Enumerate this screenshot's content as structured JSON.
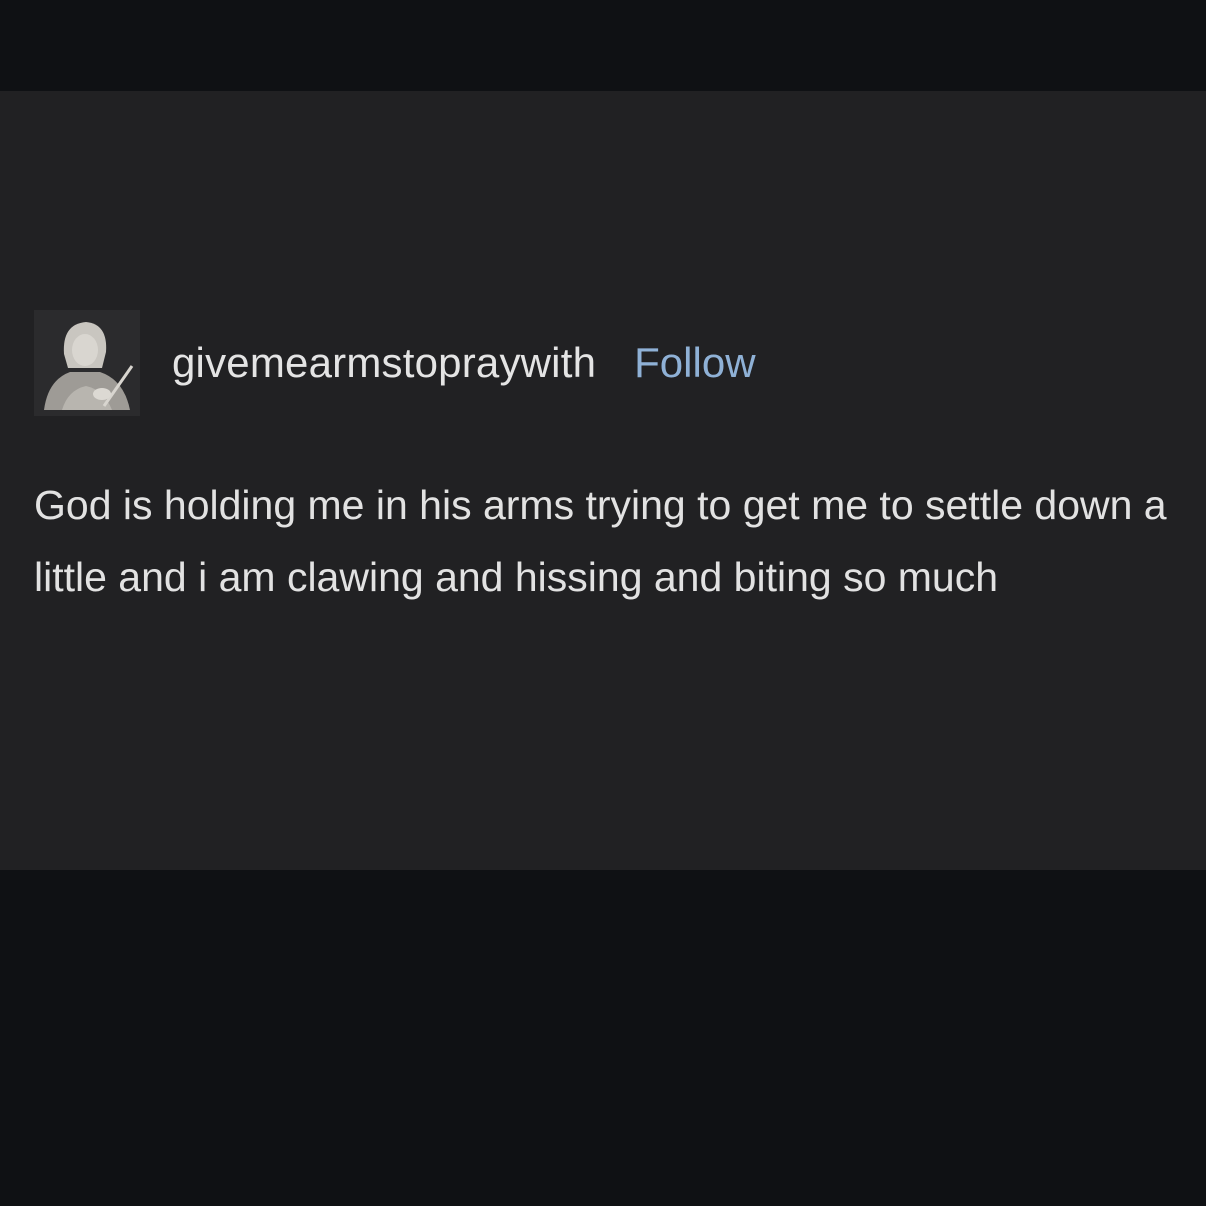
{
  "post": {
    "username": "givemearmstopraywith",
    "follow_label": "Follow",
    "body_text": "God is holding me in his arms trying to get me to settle down a little and i am clawing and hissing and biting so much"
  },
  "avatar": {
    "icon": "praying-figure-portrait-icon"
  },
  "colors": {
    "page_background": "#0f1114",
    "card_background": "#212123",
    "text": "#e2e2e2",
    "follow_link": "#8fb1d6"
  }
}
